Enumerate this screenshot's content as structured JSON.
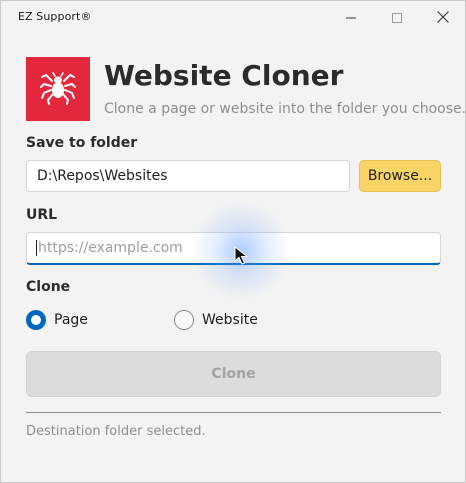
{
  "window": {
    "title": "EZ Support®",
    "controls": {
      "minimize_icon": "minimize-icon",
      "maximize_icon": "maximize-icon",
      "close_icon": "close-icon"
    }
  },
  "header": {
    "icon": "spider-icon",
    "icon_bg_color": "#e3273d",
    "title": "Website Cloner",
    "subtitle": "Clone a page or website into the folder you choose."
  },
  "save_folder": {
    "label": "Save to folder",
    "value": "D:\\Repos\\Websites",
    "browse_label": "Browse...",
    "browse_color": "#f9d466"
  },
  "url": {
    "label": "URL",
    "value": "",
    "placeholder": "https://example.com",
    "focus_color": "#0067c0"
  },
  "clone_mode": {
    "label": "Clone",
    "options": [
      {
        "label": "Page",
        "selected": true
      },
      {
        "label": "Website",
        "selected": false
      }
    ]
  },
  "clone_button": {
    "label": "Clone",
    "enabled": false
  },
  "status": {
    "text": "Destination folder selected."
  }
}
